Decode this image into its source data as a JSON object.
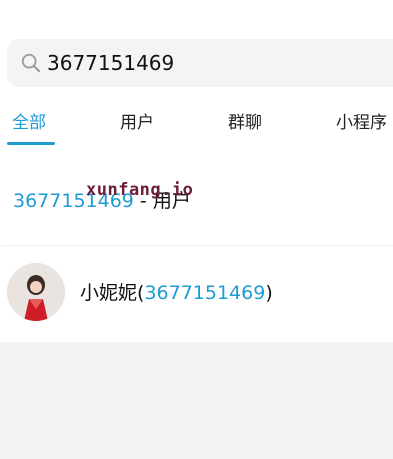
{
  "search": {
    "query": "3677151469"
  },
  "tabs": [
    "全部",
    "用户",
    "群聊",
    "小程序"
  ],
  "results": {
    "r1_highlight": "3677151469",
    "r1_suffix": " - 用户",
    "r2_name": "小妮妮",
    "r2_open": "(",
    "r2_highlight": "3677151469",
    "r2_close": ")"
  },
  "watermark": "xunfang.io",
  "colors": {
    "accent": "#1f9bd6",
    "page_bg": "#f3f3f3",
    "search_bg": "#f4f4f4"
  },
  "icons": [
    "search-icon",
    "avatar"
  ]
}
